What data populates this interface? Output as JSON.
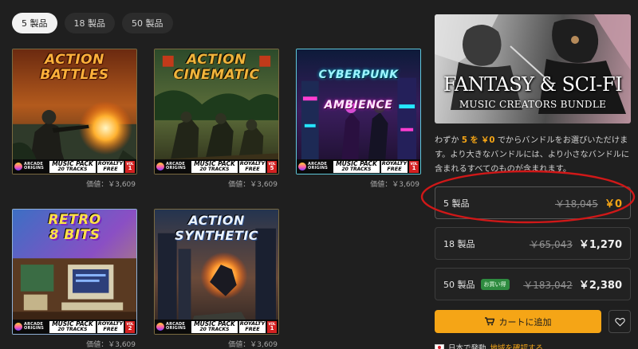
{
  "tabs": [
    {
      "label": "5 製品",
      "active": true
    },
    {
      "label": "18 製品",
      "active": false
    },
    {
      "label": "50 製品",
      "active": false
    }
  ],
  "products": [
    {
      "title": "ACTION\nBATTLES",
      "logo": "ARCADE\nORIGINS",
      "pack_line1": "MUSIC PACK",
      "pack_line2": "20 TRACKS",
      "royalty_line1": "ROYALTY",
      "royalty_line2": "FREE",
      "vol_label": "VOL",
      "vol_number": "1",
      "price": "価値：￥3,609"
    },
    {
      "title": "ACTION\nCINEMATIC",
      "logo": "ARCADE\nORIGINS",
      "pack_line1": "MUSIC PACK",
      "pack_line2": "20 TRACKS",
      "royalty_line1": "ROYALTY",
      "royalty_line2": "FREE",
      "vol_label": "VOL",
      "vol_number": "5",
      "price": "価値：￥3,609"
    },
    {
      "title_line1": "CYBERPUNK",
      "title_line2": "AMBIENCE",
      "logo": "ARCADE\nORIGINS",
      "pack_line1": "MUSIC PACK",
      "pack_line2": "20 TRACKS",
      "royalty_line1": "ROYALTY",
      "royalty_line2": "FREE",
      "vol_label": "VOL",
      "vol_number": "1",
      "price": "価値：￥3,609"
    },
    {
      "title": "RETRO\n8 BITS",
      "logo": "ARCADE\nORIGINS",
      "pack_line1": "MUSIC PACK",
      "pack_line2": "20 TRACKS",
      "royalty_line1": "ROYALTY",
      "royalty_line2": "FREE",
      "vol_label": "VOL",
      "vol_number": "2",
      "price": "価値：￥3,609"
    },
    {
      "title": "ACTION\nSYNTHETIC",
      "logo": "ARCADE\nORIGINS",
      "pack_line1": "MUSIC PACK",
      "pack_line2": "20 TRACKS",
      "royalty_line1": "ROYALTY",
      "royalty_line2": "FREE",
      "vol_label": "VOL",
      "vol_number": "1",
      "price": "価値：￥3,609"
    }
  ],
  "bundle": {
    "title": "FANTASY & SCI-FI",
    "subtitle": "MUSIC CREATORS BUNDLE",
    "description": {
      "pre": "わずか",
      "count": "5 を ￥0",
      "post": "でからバンドルをお選びいただけます。より大きなバンドルには、より小さなバンドルに含まれるすべてのものが含まれます。"
    },
    "tiers": [
      {
        "name": "5 製品",
        "old_price": "￥18,045",
        "new_price": "￥0",
        "badge": "",
        "selected": true
      },
      {
        "name": "18 製品",
        "old_price": "￥65,043",
        "new_price": "￥1,270",
        "badge": "",
        "selected": false
      },
      {
        "name": "50 製品",
        "old_price": "￥183,042",
        "new_price": "￥2,380",
        "badge": "お買い得",
        "selected": false
      }
    ],
    "cart_label": "カートに追加",
    "shipping_text": "日本で発動",
    "shipping_link": "地域を確認する"
  },
  "colors": {
    "accent": "#f5a516",
    "background": "#1f1f1f",
    "highlight_ring": "#d01818",
    "badge_green": "#2e8b3f"
  },
  "icons": {
    "cart": "cart-icon",
    "favorite": "heart-icon",
    "flag": "japan-flag-icon"
  }
}
